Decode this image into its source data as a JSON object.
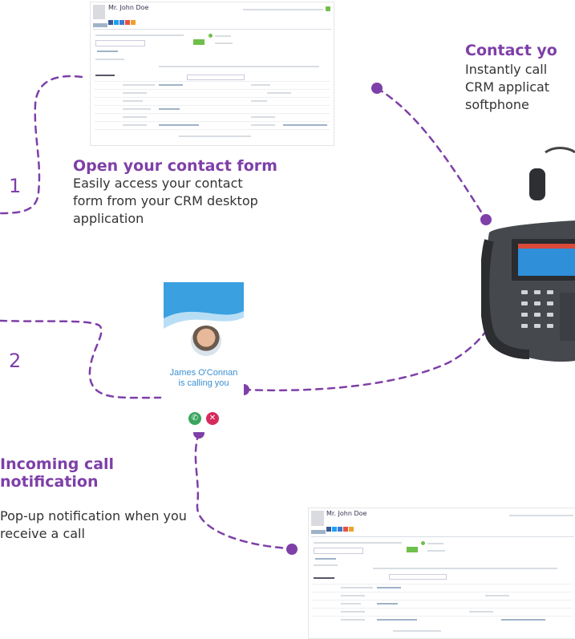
{
  "sections": {
    "contact_form": {
      "title": "Open your contact form",
      "description": "Easily access your contact form from your CRM desktop application",
      "step": "1"
    },
    "contact_call": {
      "title": "Contact yo",
      "description": "Instantly call CRM applicat softphone"
    },
    "incoming": {
      "title": "Incoming call notification",
      "description": "Pop-up notification when you receive a call",
      "step": "2"
    }
  },
  "crm_window": {
    "contact_name": "Mr. John Doe"
  },
  "popup": {
    "caller_line1": "James O'Connan",
    "caller_line2": "is calling you"
  },
  "colors": {
    "accent": "#7e3fa8",
    "popup_blue": "#3a8fd1",
    "accept": "#3aa55d",
    "reject": "#d52b5c"
  },
  "icons": [
    "phone-accept-icon",
    "reject-call-icon",
    "caller-avatar",
    "desk-phone-image"
  ]
}
